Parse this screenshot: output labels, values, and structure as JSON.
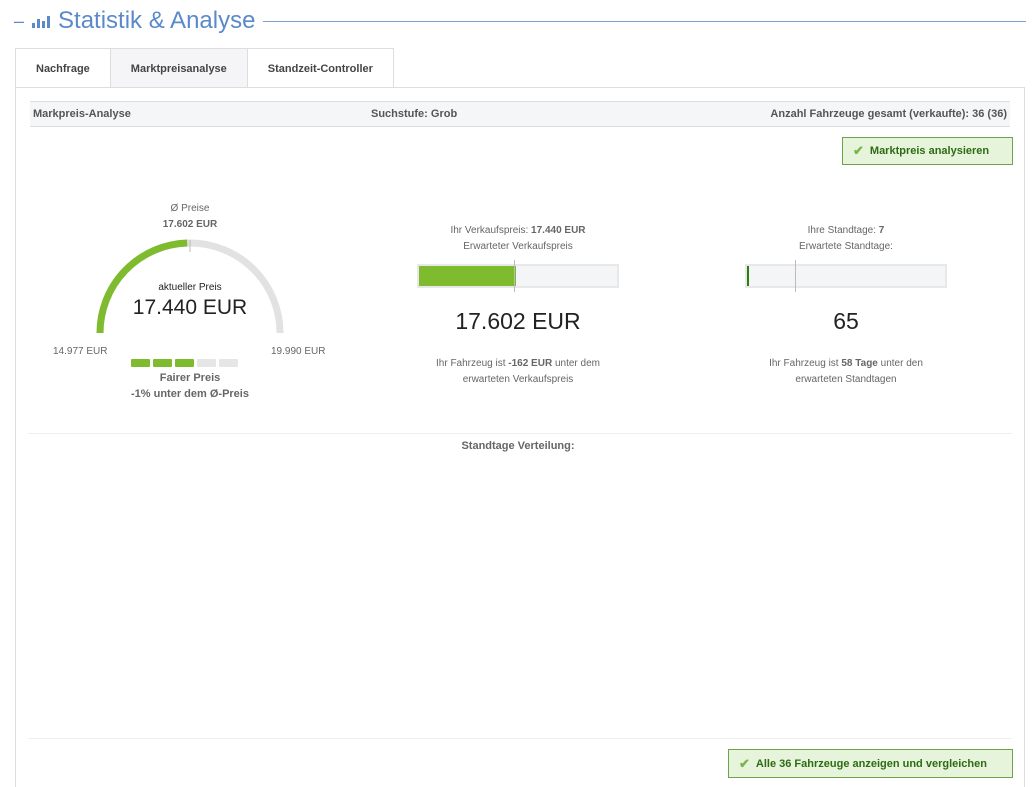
{
  "header": {
    "title": "Statistik & Analyse",
    "accent": "#5b8ac9"
  },
  "tabs": [
    {
      "label": "Nachfrage"
    },
    {
      "label": "Marktpreisanalyse",
      "active": true
    },
    {
      "label": "Standzeit-Controller"
    }
  ],
  "infobar": {
    "left": "Markpreis-Analyse",
    "center": "Suchstufe: Grob",
    "right": "Anzahl Fahrzeuge gesamt (verkaufte): 36 (36)"
  },
  "analyze_button": "Marktpreis analysieren",
  "gauge": {
    "avg_label": "Ø Preise",
    "avg_value": "17.602 EUR",
    "current_label": "aktueller Preis",
    "current_value": "17.440 EUR",
    "min": "14.977 EUR",
    "max": "19.990 EUR",
    "rating": "Fairer Preis",
    "rating_detail": "-1% unter dem Ø-Preis",
    "rating_level": 3,
    "rating_max": 5,
    "fill_fraction": 0.49
  },
  "price_panel": {
    "your_label": "Ihr Verkaufspreis:",
    "your_value": "17.440 EUR",
    "expected_label": "Erwarteter Verkaufspreis",
    "expected_value": "17.602 EUR",
    "fill_fraction": 0.49,
    "marker_fraction": 0.48,
    "note_pre": "Ihr Fahrzeug ist",
    "note_value": "-162 EUR",
    "note_post1": "unter dem",
    "note_post2": "erwarteten Verkaufspreis"
  },
  "days_panel": {
    "your_label": "Ihre Standtage:",
    "your_value": "7",
    "expected_label": "Erwartete Standtage:",
    "expected_value": "65",
    "fill_fraction": 0.01,
    "marker_fraction": 0.24,
    "note_pre": "Ihr Fahrzeug ist",
    "note_value": "58 Tage",
    "note_post1": "unter den",
    "note_post2": "erwarteten Standtagen"
  },
  "distribution_title": "Standtage Verteilung:",
  "compare_button": "Alle 36 Fahrzeuge anzeigen und vergleichen",
  "colors": {
    "green": "#7fbb2e",
    "gray": "#e2e2e2",
    "dark_green": "#2e7d12"
  }
}
